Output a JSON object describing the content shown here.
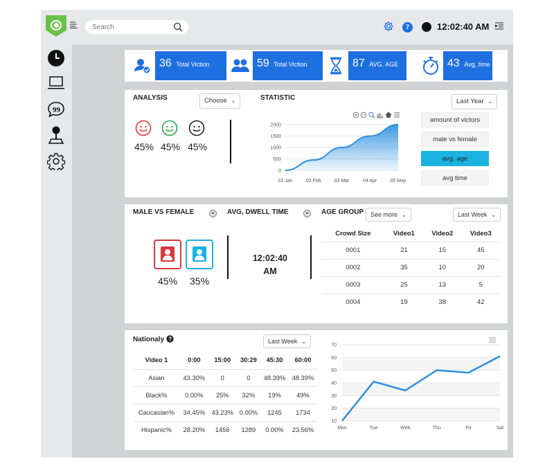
{
  "topbar": {
    "search_placeholder": "Search",
    "notification_count": "7",
    "clock": "12:02:40 AM"
  },
  "sidebar": {
    "items": [
      {
        "icon": "clock-icon"
      },
      {
        "icon": "laptop-icon"
      },
      {
        "icon": "chat-icon"
      },
      {
        "icon": "joystick-icon"
      },
      {
        "icon": "gear-icon"
      }
    ]
  },
  "stats": [
    {
      "icon": "user-check-icon",
      "value": "36",
      "label": "Total Viction"
    },
    {
      "icon": "users-icon",
      "value": "59",
      "label": "Total Viction"
    },
    {
      "icon": "hourglass-icon",
      "value": "87",
      "label": "AVG, AGE"
    },
    {
      "icon": "stopwatch-icon",
      "value": "43",
      "label": "Avg, time"
    }
  ],
  "analysis": {
    "title": "ANALYSIS",
    "dropdown": "Choose",
    "moods": [
      {
        "icon": "smile-red-icon",
        "color": "#e0333c",
        "pct": "45%"
      },
      {
        "icon": "smile-green-icon",
        "color": "#2aa84a",
        "pct": "45%"
      },
      {
        "icon": "smile-black-icon",
        "color": "#222222",
        "pct": "45%"
      }
    ]
  },
  "statistic": {
    "title": "STATISTIC",
    "dropdown": "Last Year",
    "options": [
      "amount of victors",
      "male vs female",
      "avg, age",
      "avg time"
    ],
    "active_option": 2,
    "chart_data": {
      "type": "area",
      "x": [
        "01 Jan",
        "02 Feb",
        "03 Mar",
        "04 Apr",
        "05 May"
      ],
      "values": [
        0,
        450,
        1000,
        1500,
        2000
      ],
      "ylim": [
        0,
        2000
      ],
      "yticks": [
        0,
        500,
        1000,
        1500,
        2000
      ],
      "color": "#2b8fe0"
    }
  },
  "gender": {
    "title": "MALE VS FEMALE",
    "items": [
      {
        "icon": "female-card-icon",
        "color": "#d9393f",
        "pct": "45%"
      },
      {
        "icon": "male-card-icon",
        "color": "#1ab2e0",
        "pct": "35%"
      }
    ]
  },
  "dwell": {
    "title": "AVG, DWELL TIME",
    "time_line1": "12:02:40",
    "time_line2": "AM"
  },
  "age_group": {
    "title": "AGE GROUP",
    "see_more": "See more",
    "dropdown": "Last Week",
    "headers": [
      "Crowd Size",
      "Video1",
      "Video2",
      "Video3"
    ],
    "rows": [
      [
        "0001",
        "21",
        "15",
        "45"
      ],
      [
        "0002",
        "35",
        "10",
        "20"
      ],
      [
        "0003",
        "25",
        "13",
        "5"
      ],
      [
        "0004",
        "19",
        "38",
        "42"
      ]
    ]
  },
  "nationality": {
    "title": "Nationaly",
    "dropdown": "Last Week",
    "headers": [
      "Video 1",
      "0:00",
      "15:00",
      "30:29",
      "45:30",
      "60:00"
    ],
    "rows": [
      [
        "Asian",
        "43.30%",
        "0",
        "0",
        "48.39%",
        "48.39%"
      ],
      [
        "Black%",
        "0.00%",
        "25%",
        "32%",
        "19%",
        "49%"
      ],
      [
        "Caucasian%",
        "34.45%",
        "43.23%",
        "0.00%",
        "1245",
        "1734"
      ],
      [
        "Hispanic%",
        "28.20%",
        "1456",
        "1289",
        "0.00%",
        "23.56%"
      ]
    ],
    "chart_data": {
      "type": "line",
      "x": [
        "Mon",
        "Tue",
        "Web",
        "Thu",
        "Fri",
        "Sat"
      ],
      "values": [
        10,
        41,
        34,
        50,
        48,
        61
      ],
      "ylim": [
        10,
        70
      ],
      "yticks": [
        10,
        20,
        30,
        40,
        50,
        60,
        70
      ],
      "color": "#2b8fe0"
    }
  }
}
